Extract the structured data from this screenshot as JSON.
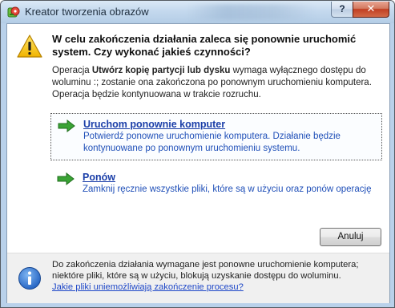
{
  "window": {
    "title": "Kreator tworzenia obrazów",
    "help_glyph": "?",
    "close_glyph": "✕"
  },
  "message": {
    "headline": "W celu zakończenia działania zaleca się ponownie uruchomić system. Czy wykonać jakieś czynności?",
    "desc_part1": "Operacja ",
    "desc_bold": "Utwórz kopię partycji lub dysku",
    "desc_part2": " wymaga wyłącznego dostępu do woluminu :; zostanie ona zakończona po ponownym uruchomieniu komputera. Operacja będzie kontynuowana w trakcie rozruchu."
  },
  "options": [
    {
      "title": "Uruchom ponownie komputer",
      "description": "Potwierdź ponowne uruchomienie komputera. Działanie będzie kontynuowane po ponownym uruchomieniu systemu.",
      "selected": true
    },
    {
      "title": "Ponów",
      "description": "Zamknij ręcznie wszystkie pliki, które są w użyciu oraz ponów operację",
      "selected": false
    }
  ],
  "buttons": {
    "cancel": "Anuluj"
  },
  "footer": {
    "text": "Do zakończenia działania wymagane jest ponowne uruchomienie komputera; niektóre pliki, które są w użyciu, blokują uzyskanie dostępu do woluminu.",
    "link": "Jakie pliki uniemożliwiają zakończenie procesu?"
  },
  "icons": {
    "app": "disk-image-icon",
    "warning": "warning-icon",
    "option_arrow": "green-arrow-icon",
    "info": "info-icon"
  },
  "colors": {
    "link_blue": "#1a3ea8",
    "close_red": "#c13f23",
    "warning_yellow": "#f5c400",
    "info_blue": "#2a6fd4",
    "arrow_green": "#3aa335"
  }
}
